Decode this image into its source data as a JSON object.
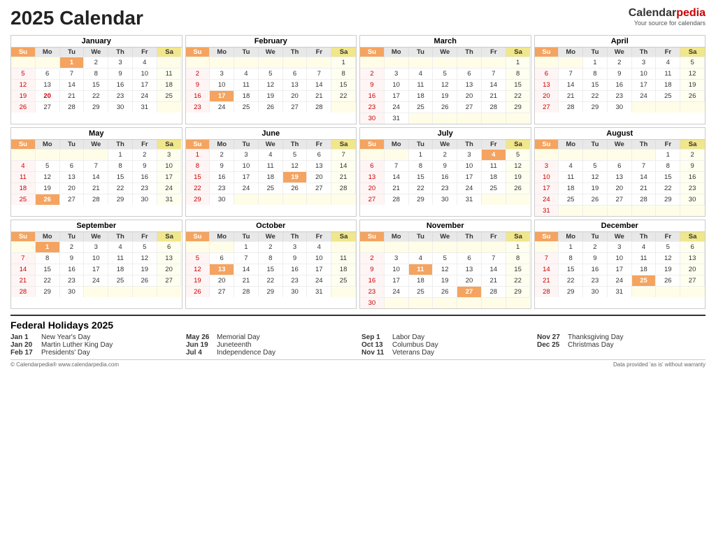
{
  "title": "2025 Calendar",
  "logo": {
    "brand1": "Calendar",
    "brand2": "pedia",
    "tagline": "Your source for calendars"
  },
  "months": [
    {
      "name": "January",
      "startDow": 3,
      "days": 31,
      "holidays": [
        1
      ],
      "specials": [
        20
      ],
      "weeks": [
        [
          "",
          "",
          "1",
          "2",
          "3",
          "4",
          ""
        ],
        [
          "5",
          "6",
          "7",
          "8",
          "9",
          "10",
          "11"
        ],
        [
          "12",
          "13",
          "14",
          "15",
          "16",
          "17",
          "18"
        ],
        [
          "19",
          "20",
          "21",
          "22",
          "23",
          "24",
          "25"
        ],
        [
          "26",
          "27",
          "28",
          "29",
          "30",
          "31",
          ""
        ]
      ]
    },
    {
      "name": "February",
      "startDow": 6,
      "days": 28,
      "holidays": [
        17
      ],
      "specials": [],
      "weeks": [
        [
          "",
          "",
          "",
          "",
          "",
          "",
          "1"
        ],
        [
          "2",
          "3",
          "4",
          "5",
          "6",
          "7",
          "8"
        ],
        [
          "9",
          "10",
          "11",
          "12",
          "13",
          "14",
          "15"
        ],
        [
          "16",
          "17",
          "18",
          "19",
          "20",
          "21",
          "22"
        ],
        [
          "23",
          "24",
          "25",
          "26",
          "27",
          "28",
          ""
        ]
      ]
    },
    {
      "name": "March",
      "startDow": 6,
      "days": 31,
      "holidays": [],
      "specials": [],
      "weeks": [
        [
          "",
          "",
          "",
          "",
          "",
          "",
          "1"
        ],
        [
          "2",
          "3",
          "4",
          "5",
          "6",
          "7",
          "8"
        ],
        [
          "9",
          "10",
          "11",
          "12",
          "13",
          "14",
          "15"
        ],
        [
          "16",
          "17",
          "18",
          "19",
          "20",
          "21",
          "22"
        ],
        [
          "23",
          "24",
          "25",
          "26",
          "27",
          "28",
          "29"
        ],
        [
          "30",
          "31",
          "",
          "",
          "",
          "",
          ""
        ]
      ]
    },
    {
      "name": "April",
      "startDow": 2,
      "days": 30,
      "holidays": [],
      "specials": [],
      "weeks": [
        [
          "",
          "",
          "1",
          "2",
          "3",
          "4",
          "5"
        ],
        [
          "6",
          "7",
          "8",
          "9",
          "10",
          "11",
          "12"
        ],
        [
          "13",
          "14",
          "15",
          "16",
          "17",
          "18",
          "19"
        ],
        [
          "20",
          "21",
          "22",
          "23",
          "24",
          "25",
          "26"
        ],
        [
          "27",
          "28",
          "29",
          "30",
          "",
          "",
          ""
        ]
      ]
    },
    {
      "name": "May",
      "startDow": 4,
      "days": 31,
      "holidays": [
        26
      ],
      "specials": [],
      "weeks": [
        [
          "",
          "",
          "",
          "",
          "1",
          "2",
          "3"
        ],
        [
          "4",
          "5",
          "6",
          "7",
          "8",
          "9",
          "10"
        ],
        [
          "11",
          "12",
          "13",
          "14",
          "15",
          "16",
          "17"
        ],
        [
          "18",
          "19",
          "20",
          "21",
          "22",
          "23",
          "24"
        ],
        [
          "25",
          "26",
          "27",
          "28",
          "29",
          "30",
          "31"
        ]
      ]
    },
    {
      "name": "June",
      "startDow": 0,
      "days": 30,
      "holidays": [
        19
      ],
      "specials": [],
      "weeks": [
        [
          "1",
          "2",
          "3",
          "4",
          "5",
          "6",
          "7"
        ],
        [
          "8",
          "9",
          "10",
          "11",
          "12",
          "13",
          "14"
        ],
        [
          "15",
          "16",
          "17",
          "18",
          "19",
          "20",
          "21"
        ],
        [
          "22",
          "23",
          "24",
          "25",
          "26",
          "27",
          "28"
        ],
        [
          "29",
          "30",
          "",
          "",
          "",
          "",
          ""
        ]
      ]
    },
    {
      "name": "July",
      "startDow": 2,
      "days": 31,
      "holidays": [
        4
      ],
      "specials": [],
      "weeks": [
        [
          "",
          "",
          "1",
          "2",
          "3",
          "4",
          "5"
        ],
        [
          "6",
          "7",
          "8",
          "9",
          "10",
          "11",
          "12"
        ],
        [
          "13",
          "14",
          "15",
          "16",
          "17",
          "18",
          "19"
        ],
        [
          "20",
          "21",
          "22",
          "23",
          "24",
          "25",
          "26"
        ],
        [
          "27",
          "28",
          "29",
          "30",
          "31",
          "",
          ""
        ]
      ]
    },
    {
      "name": "August",
      "startDow": 5,
      "days": 31,
      "holidays": [],
      "specials": [],
      "weeks": [
        [
          "",
          "",
          "",
          "",
          "",
          "1",
          "2"
        ],
        [
          "3",
          "4",
          "5",
          "6",
          "7",
          "8",
          "9"
        ],
        [
          "10",
          "11",
          "12",
          "13",
          "14",
          "15",
          "16"
        ],
        [
          "17",
          "18",
          "19",
          "20",
          "21",
          "22",
          "23"
        ],
        [
          "24",
          "25",
          "26",
          "27",
          "28",
          "29",
          "30"
        ],
        [
          "31",
          "",
          "",
          "",
          "",
          "",
          ""
        ]
      ]
    },
    {
      "name": "September",
      "startDow": 1,
      "days": 30,
      "holidays": [
        1
      ],
      "specials": [],
      "weeks": [
        [
          "",
          "1",
          "2",
          "3",
          "4",
          "5",
          "6"
        ],
        [
          "7",
          "8",
          "9",
          "10",
          "11",
          "12",
          "13"
        ],
        [
          "14",
          "15",
          "16",
          "17",
          "18",
          "19",
          "20"
        ],
        [
          "21",
          "22",
          "23",
          "24",
          "25",
          "26",
          "27"
        ],
        [
          "28",
          "29",
          "30",
          "",
          "",
          "",
          ""
        ]
      ]
    },
    {
      "name": "October",
      "startDow": 3,
      "days": 31,
      "holidays": [
        13
      ],
      "specials": [],
      "weeks": [
        [
          "",
          "",
          "1",
          "2",
          "3",
          "4",
          ""
        ],
        [
          "5",
          "6",
          "7",
          "8",
          "9",
          "10",
          "11"
        ],
        [
          "12",
          "13",
          "14",
          "15",
          "16",
          "17",
          "18"
        ],
        [
          "19",
          "20",
          "21",
          "22",
          "23",
          "24",
          "25"
        ],
        [
          "26",
          "27",
          "28",
          "29",
          "30",
          "31",
          ""
        ]
      ]
    },
    {
      "name": "November",
      "startDow": 6,
      "days": 30,
      "holidays": [
        11,
        27
      ],
      "specials": [
        27
      ],
      "weeks": [
        [
          "",
          "",
          "",
          "",
          "",
          "",
          "1"
        ],
        [
          "2",
          "3",
          "4",
          "5",
          "6",
          "7",
          "8"
        ],
        [
          "9",
          "10",
          "11",
          "12",
          "13",
          "14",
          "15"
        ],
        [
          "16",
          "17",
          "18",
          "19",
          "20",
          "21",
          "22"
        ],
        [
          "23",
          "24",
          "25",
          "26",
          "27",
          "28",
          "29"
        ],
        [
          "30",
          "",
          "",
          "",
          "",
          "",
          ""
        ]
      ]
    },
    {
      "name": "December",
      "startDow": 1,
      "days": 31,
      "holidays": [
        25
      ],
      "specials": [
        25
      ],
      "weeks": [
        [
          "",
          "1",
          "2",
          "3",
          "4",
          "5",
          "6"
        ],
        [
          "7",
          "8",
          "9",
          "10",
          "11",
          "12",
          "13"
        ],
        [
          "14",
          "15",
          "16",
          "17",
          "18",
          "19",
          "20"
        ],
        [
          "21",
          "22",
          "23",
          "24",
          "25",
          "26",
          "27"
        ],
        [
          "28",
          "29",
          "30",
          "31",
          "",
          "",
          ""
        ]
      ]
    }
  ],
  "dow_labels": [
    "Su",
    "Mo",
    "Tu",
    "We",
    "Th",
    "Fr",
    "Sa"
  ],
  "holidays_title": "Federal Holidays 2025",
  "holidays": [
    {
      "date": "Jan 1",
      "name": "New Year's Day"
    },
    {
      "date": "Jan 20",
      "name": "Martin Luther King Day"
    },
    {
      "date": "Feb 17",
      "name": "Presidents' Day"
    },
    {
      "date": "May 26",
      "name": "Memorial Day"
    },
    {
      "date": "Jun 19",
      "name": "Juneteenth"
    },
    {
      "date": "Jul 4",
      "name": "Independence Day"
    },
    {
      "date": "Sep 1",
      "name": "Labor Day"
    },
    {
      "date": "Oct 13",
      "name": "Columbus Day"
    },
    {
      "date": "Nov 11",
      "name": "Veterans Day"
    },
    {
      "date": "Nov 27",
      "name": "Thanksgiving Day"
    },
    {
      "date": "Dec 25",
      "name": "Christmas Day"
    }
  ],
  "footer_left": "© Calendarpedia®  www.calendarpedia.com",
  "footer_right": "Data provided 'as is' without warranty"
}
